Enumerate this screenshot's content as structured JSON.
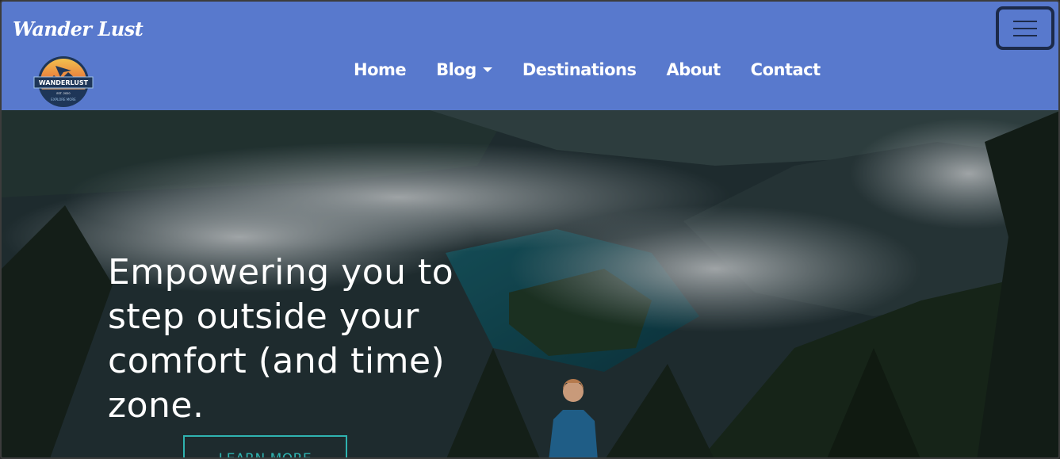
{
  "brand": {
    "name": "Wander Lust"
  },
  "logo": {
    "name": "WANDERLUST",
    "est": "EST. 2020",
    "tagline": "EXPLORE MORE"
  },
  "nav": {
    "items": [
      {
        "label": "Home"
      },
      {
        "label": "Blog",
        "has_dropdown": true
      },
      {
        "label": "Destinations"
      },
      {
        "label": "About"
      },
      {
        "label": "Contact"
      }
    ]
  },
  "toggler": {
    "icon": "hamburger-menu-icon"
  },
  "hero": {
    "headline": "Empowering you to step outside your comfort (and time) zone.",
    "cta_label": "LEARN MORE"
  },
  "colors": {
    "navbar": "#5879cd",
    "toggler_border": "#1c2a4a",
    "cta": "#2fb3b0"
  }
}
